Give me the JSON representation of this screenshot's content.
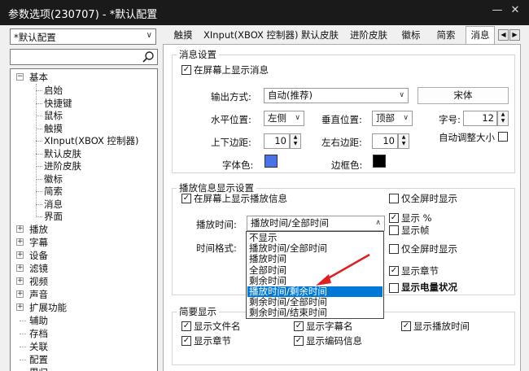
{
  "window": {
    "title": "参数选项(230707) - *默认配置"
  },
  "left": {
    "preset": "*默认配置",
    "tree": {
      "basic": "基本",
      "basic_children": [
        "启始",
        "快捷键",
        "鼠标",
        "触摸",
        "XInput(XBOX 控制器)",
        "默认皮肤",
        "进阶皮肤",
        "徽标",
        "简索",
        "消息",
        "界面"
      ],
      "roots": [
        "播放",
        "字幕",
        "设备",
        "滤镜",
        "视频",
        "声音",
        "扩展功能",
        "辅助",
        "存档",
        "关联",
        "配置",
        "累归"
      ]
    }
  },
  "tabs": [
    "触摸",
    "XInput(XBOX 控制器)",
    "默认皮肤",
    "进阶皮肤",
    "徽标",
    "简索",
    "消息"
  ],
  "msg": {
    "group_title": "消息设置",
    "show_on_screen": "在屏幕上显示消息",
    "output_label": "输出方式:",
    "output_value": "自动(推荐)",
    "font_button": "宋体",
    "hpos_label": "水平位置:",
    "hpos_value": "左侧",
    "vpos_label": "垂直位置:",
    "vpos_value": "顶部",
    "size_label": "字号:",
    "size_value": "12",
    "tb_margin_label": "上下边距:",
    "tb_margin_value": "10",
    "lr_margin_label": "左右边距:",
    "lr_margin_value": "10",
    "auto_size": "自动调整大小",
    "font_color_label": "字体色:",
    "font_color": "#4a72e8",
    "border_color_label": "边框色:",
    "border_color": "#000000"
  },
  "play": {
    "group_title": "播放信息显示设置",
    "show_play_info": "在屏幕上显示播放信息",
    "fullscreen_only": "仅全屏时显示",
    "play_time_label": "播放时间:",
    "play_time_value": "播放时间/全部时间",
    "time_format_label": "时间格式:",
    "show_percent": "显示 %",
    "show_frame": "显示帧",
    "fullscreen_only2": "仅全屏时显示",
    "show_chapter": "显示章节",
    "show_battery": "显示电量状况",
    "options": [
      "不显示",
      "播放时间/全部时间",
      "播放时间",
      "全部时间",
      "剩余时间",
      "播放时间/剩余时间",
      "剩余时间/全部时间",
      "剩余时间/结束时间"
    ],
    "highlighted_option": "播放时间/剩余时间"
  },
  "brief": {
    "group_title": "简要显示",
    "items": [
      "显示文件名",
      "显示字幕名",
      "显示播放时间",
      "显示章节",
      "显示编码信息"
    ]
  },
  "colors": {
    "highlight": "#0078d7",
    "arrow": "#e02020"
  }
}
